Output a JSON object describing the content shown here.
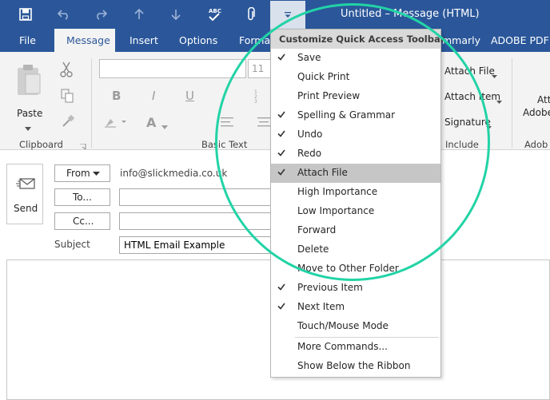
{
  "window": {
    "title": "Untitled – Message (HTML)"
  },
  "qat": {
    "icons": [
      "save-icon",
      "undo-icon",
      "redo-icon",
      "previous-item-icon",
      "next-item-icon",
      "spelling-abc-icon",
      "attach-paperclip-icon",
      "customize-dropdown-icon"
    ],
    "spelling_icon_text": "ABC"
  },
  "tabs": [
    "File",
    "Message",
    "Insert",
    "Options",
    "Format",
    "mmarly",
    "ADOBE PDF"
  ],
  "ribbon": {
    "clipboard": {
      "paste": "Paste",
      "label": "Clipboard"
    },
    "basic_text": {
      "label": "Basic Text",
      "font_size": "11",
      "bold": "B",
      "italic": "I",
      "underline": "U",
      "font_color": "A"
    },
    "include": {
      "attach_file": "Attach File",
      "attach_item": "Attach Item",
      "signature": "Signature",
      "label": "Include"
    },
    "adobe": {
      "line1": "Att",
      "line2": "Adobe",
      "label": "Adob"
    }
  },
  "compose": {
    "send": "Send",
    "from": "From",
    "from_value": "info@slickmedia.co.uk",
    "to": "To...",
    "cc": "Cc...",
    "subject_label": "Subject",
    "subject_value": "HTML Email Example"
  },
  "menu": {
    "title": "Customize Quick Access Toolbar",
    "items": [
      {
        "label": "Save",
        "checked": true
      },
      {
        "label": "Quick Print",
        "checked": false
      },
      {
        "label": "Print Preview",
        "checked": false
      },
      {
        "label": "Spelling & Grammar",
        "checked": true
      },
      {
        "label": "Undo",
        "checked": true
      },
      {
        "label": "Redo",
        "checked": true
      },
      {
        "label": "Attach File",
        "checked": true,
        "highlighted": true
      },
      {
        "label": "High Importance",
        "checked": false
      },
      {
        "label": "Low Importance",
        "checked": false
      },
      {
        "label": "Forward",
        "checked": false
      },
      {
        "label": "Delete",
        "checked": false
      },
      {
        "label": "Move to Other Folder",
        "checked": false
      },
      {
        "label": "Previous Item",
        "checked": true
      },
      {
        "label": "Next Item",
        "checked": true
      },
      {
        "label": "Touch/Mouse Mode",
        "checked": false
      },
      {
        "label": "More Commands...",
        "checked": false
      },
      {
        "label": "Show Below the Ribbon",
        "checked": false
      }
    ]
  },
  "colors": {
    "titlebar": "#2b579a",
    "ribbon": "#f3f3f3",
    "annotation_circle": "#22d3a6",
    "menu_highlight": "#c6c6c6"
  }
}
